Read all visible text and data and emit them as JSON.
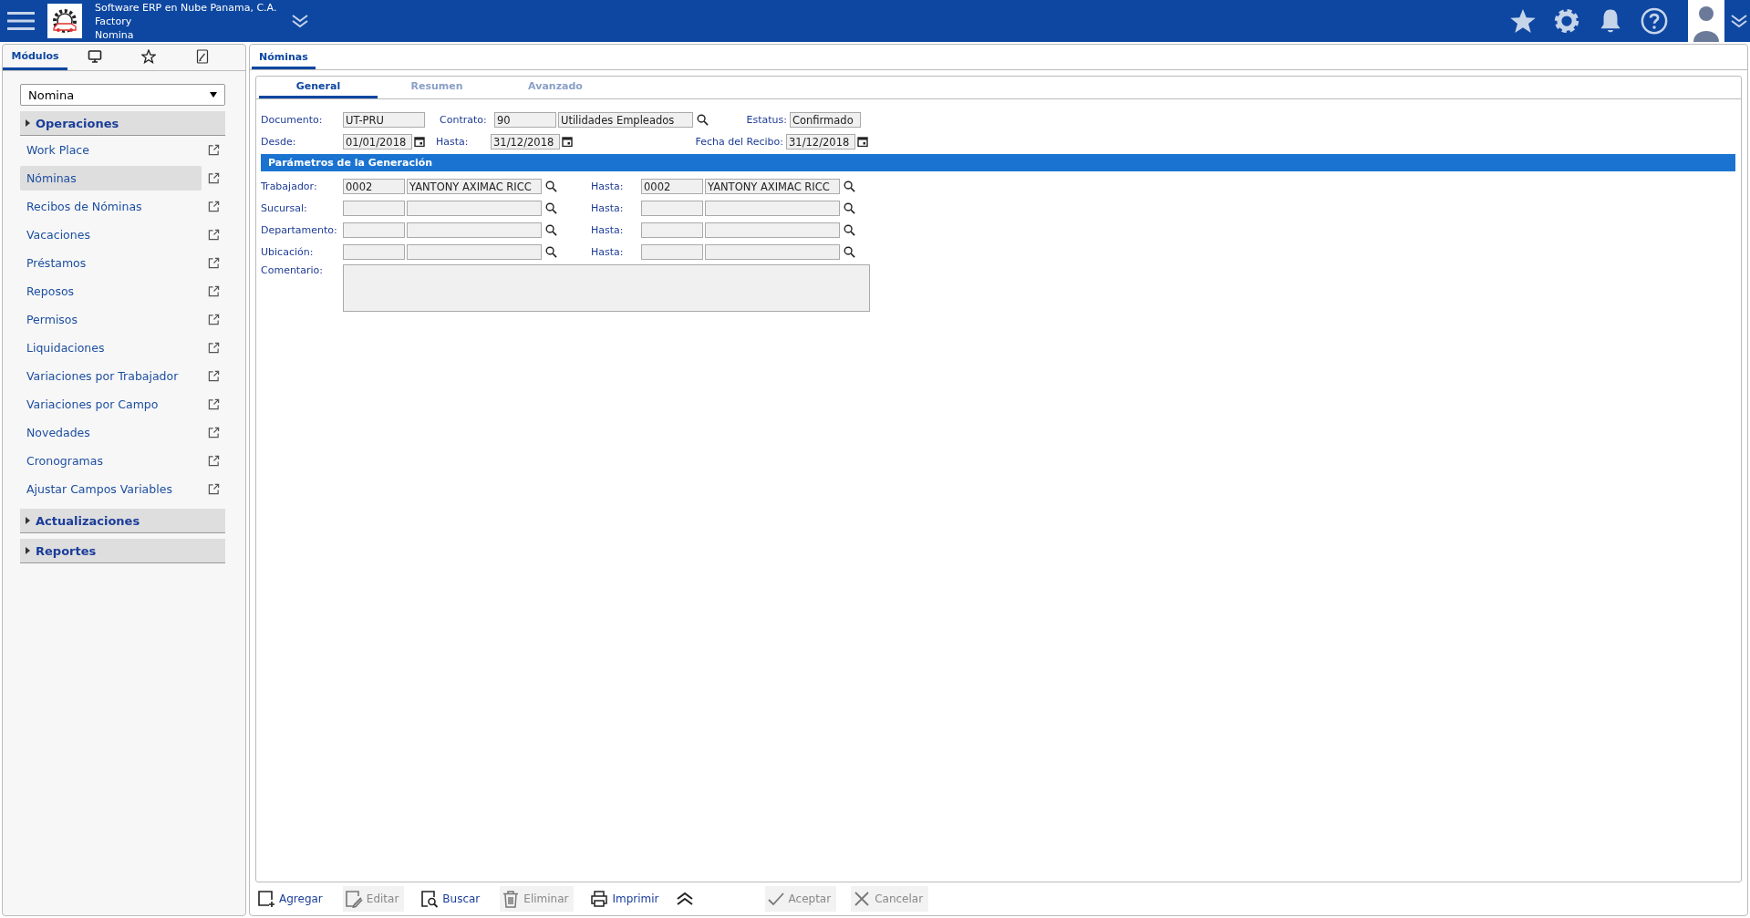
{
  "header": {
    "company": "Software ERP en Nube Panama, C.A.",
    "branch": "Factory",
    "module": "Nomina"
  },
  "sidebar": {
    "tabs": [
      {
        "kind": "label",
        "label": "Módulos",
        "selected": true
      },
      {
        "kind": "screen",
        "selected": false
      },
      {
        "kind": "star",
        "selected": false
      },
      {
        "kind": "note",
        "selected": false
      }
    ],
    "module_select": {
      "value": "Nomina"
    },
    "sections": [
      {
        "title": "Operaciones",
        "items": [
          {
            "label": "Work Place",
            "selected": false
          },
          {
            "label": "Nóminas",
            "selected": true
          },
          {
            "label": "Recibos de Nóminas",
            "selected": false
          },
          {
            "label": "Vacaciones",
            "selected": false
          },
          {
            "label": "Préstamos",
            "selected": false
          },
          {
            "label": "Reposos",
            "selected": false
          },
          {
            "label": "Permisos",
            "selected": false
          },
          {
            "label": "Liquidaciones",
            "selected": false
          },
          {
            "label": "Variaciones por Trabajador",
            "selected": false
          },
          {
            "label": "Variaciones por Campo",
            "selected": false
          },
          {
            "label": "Novedades",
            "selected": false
          },
          {
            "label": "Cronogramas",
            "selected": false
          },
          {
            "label": "Ajustar Campos Variables",
            "selected": false
          }
        ]
      },
      {
        "title": "Actualizaciones"
      },
      {
        "title": "Reportes"
      }
    ]
  },
  "page_tabs": [
    {
      "label": "Nóminas",
      "selected": true
    }
  ],
  "form_tabs": [
    {
      "label": "General",
      "selected": true
    },
    {
      "label": "Resumen",
      "selected": false
    },
    {
      "label": "Avanzado",
      "selected": false
    }
  ],
  "form": {
    "documento": {
      "label": "Documento:",
      "value": "UT-PRU"
    },
    "contrato": {
      "label": "Contrato:",
      "code": "90",
      "name": "Utilidades Empleados"
    },
    "estatus": {
      "label": "Estatus:",
      "value": "Confirmado"
    },
    "desde": {
      "label": "Desde:",
      "value": "01/01/2018"
    },
    "hasta": {
      "label": "Hasta:",
      "value": "31/12/2018"
    },
    "fecha_recibo": {
      "label": "Fecha del Recibo:",
      "value": "31/12/2018"
    }
  },
  "section_title": "Parámetros de la Generación",
  "ranges": [
    {
      "label": "Trabajador:",
      "from_code": "0002",
      "from_name": "YANTONY AXIMAC RICC",
      "to_label": "Hasta:",
      "to_code": "0002",
      "to_name": "YANTONY AXIMAC RICC"
    },
    {
      "label": "Sucursal:",
      "to_label": "Hasta:"
    },
    {
      "label": "Departamento:",
      "to_label": "Hasta:"
    },
    {
      "label": "Ubicación:",
      "to_label": "Hasta:"
    }
  ],
  "comment": {
    "label": "Comentario:"
  },
  "toolbar": {
    "actions": [
      {
        "kind": "add",
        "label": "Agregar",
        "disabled": false
      },
      {
        "kind": "edit",
        "label": "Editar",
        "disabled": true
      },
      {
        "kind": "search",
        "label": "Buscar",
        "disabled": false
      },
      {
        "kind": "delete",
        "label": "Eliminar",
        "disabled": true
      },
      {
        "kind": "print",
        "label": "Imprimir",
        "disabled": false
      }
    ],
    "confirm": [
      {
        "kind": "accept",
        "label": "Aceptar",
        "disabled": true
      },
      {
        "kind": "cancel",
        "label": "Cancelar",
        "disabled": true
      }
    ]
  }
}
